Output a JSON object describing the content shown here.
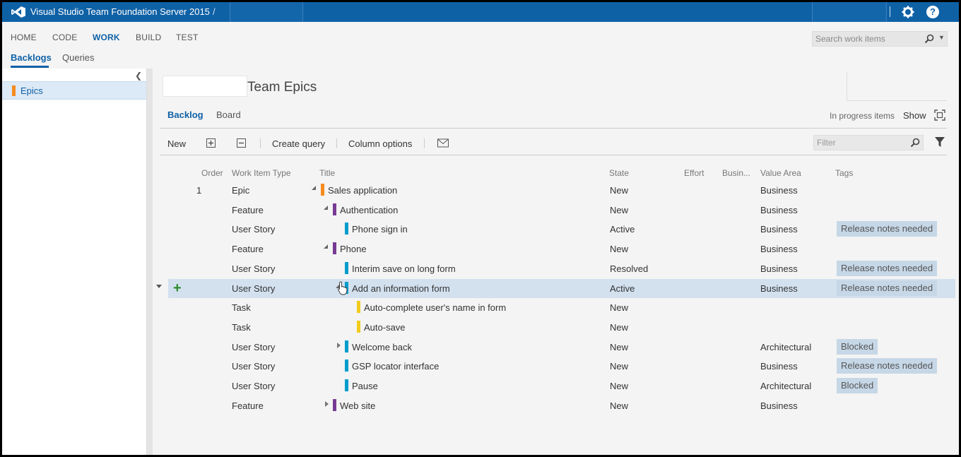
{
  "titlebar": {
    "title": "Visual Studio Team Foundation Server 2015",
    "separator": "/",
    "icons": [
      "vs-logo-icon",
      "gear-icon",
      "help-icon"
    ],
    "help_glyph": "?"
  },
  "hubs": [
    {
      "label": "HOME"
    },
    {
      "label": "CODE"
    },
    {
      "label": "WORK",
      "active": true
    },
    {
      "label": "BUILD"
    },
    {
      "label": "TEST"
    }
  ],
  "subhubs": [
    {
      "label": "Backlogs",
      "active": true
    },
    {
      "label": "Queries"
    }
  ],
  "search": {
    "placeholder": "Search work items"
  },
  "left_pane": {
    "items": [
      {
        "label": "Epics",
        "color": "#f58b1f"
      }
    ]
  },
  "page": {
    "team_title": "Team Epics",
    "pivots": [
      {
        "label": "Backlog",
        "active": true
      },
      {
        "label": "Board"
      }
    ],
    "in_progress_label": "In progress items",
    "show_label": "Show"
  },
  "toolbar": {
    "new_label": "New",
    "create_query_label": "Create query",
    "column_options_label": "Column options",
    "filter_placeholder": "Filter"
  },
  "columns": [
    "Order",
    "Work Item Type",
    "Title",
    "State",
    "Effort",
    "Busin...",
    "Value Area",
    "Tags"
  ],
  "colors": {
    "epic": "#f58b1f",
    "feature": "#773b93",
    "user_story": "#009ccc",
    "task": "#f2cb1d",
    "accent": "#0f61a6",
    "selected_row": "#d3e1ef"
  },
  "rows": [
    {
      "order": "1",
      "type": "Epic",
      "title": "Sales application",
      "state": "New",
      "value_area": "Business",
      "tag": ""
    },
    {
      "order": "",
      "type": "Feature",
      "title": "Authentication",
      "state": "New",
      "value_area": "Business",
      "tag": ""
    },
    {
      "order": "",
      "type": "User Story",
      "title": "Phone sign in",
      "state": "Active",
      "value_area": "Business",
      "tag": "Release notes needed"
    },
    {
      "order": "",
      "type": "Feature",
      "title": "Phone",
      "state": "New",
      "value_area": "Business",
      "tag": ""
    },
    {
      "order": "",
      "type": "User Story",
      "title": "Interim save on long form",
      "state": "Resolved",
      "value_area": "Business",
      "tag": "Release notes needed"
    },
    {
      "order": "",
      "type": "User Story",
      "title": "Add an information form",
      "state": "Active",
      "value_area": "Business",
      "tag": "Release notes needed",
      "selected": true
    },
    {
      "order": "",
      "type": "Task",
      "title": "Auto-complete user's name in form",
      "state": "New",
      "value_area": "",
      "tag": ""
    },
    {
      "order": "",
      "type": "Task",
      "title": "Auto-save",
      "state": "New",
      "value_area": "",
      "tag": ""
    },
    {
      "order": "",
      "type": "User Story",
      "title": "Welcome back",
      "state": "New",
      "value_area": "Architectural",
      "tag": "Blocked"
    },
    {
      "order": "",
      "type": "User Story",
      "title": "GSP locator interface",
      "state": "New",
      "value_area": "Business",
      "tag": "Release notes needed"
    },
    {
      "order": "",
      "type": "User Story",
      "title": "Pause",
      "state": "New",
      "value_area": "Architectural",
      "tag": "Blocked"
    },
    {
      "order": "",
      "type": "Feature",
      "title": "Web site",
      "state": "New",
      "value_area": "Business",
      "tag": ""
    }
  ]
}
